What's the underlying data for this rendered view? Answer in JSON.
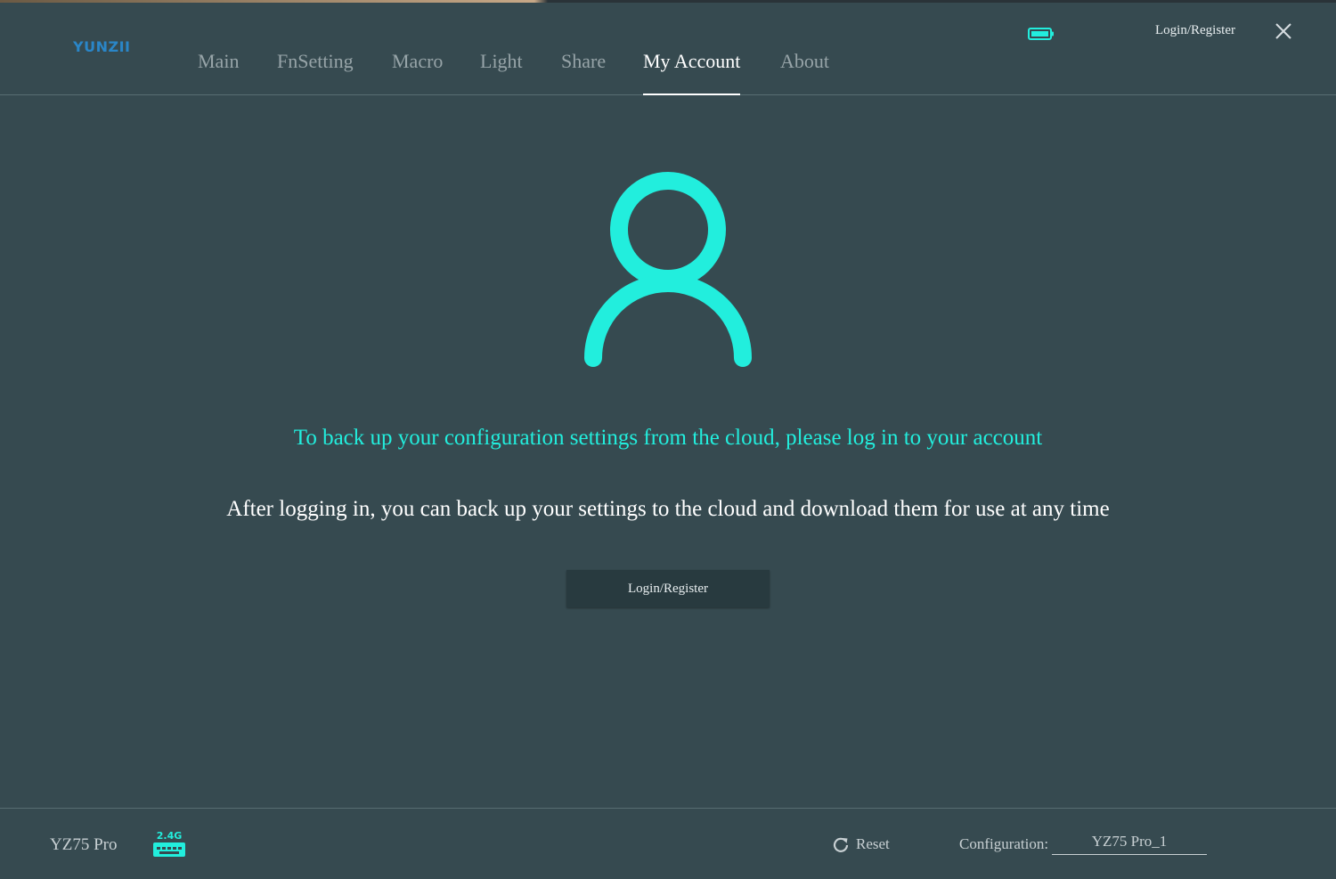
{
  "header": {
    "logo": "YUNZII",
    "tabs": [
      {
        "label": "Main",
        "active": false
      },
      {
        "label": "FnSetting",
        "active": false
      },
      {
        "label": "Macro",
        "active": false
      },
      {
        "label": "Light",
        "active": false
      },
      {
        "label": "Share",
        "active": false
      },
      {
        "label": "My Account",
        "active": true
      },
      {
        "label": "About",
        "active": false
      }
    ],
    "login_label": "Login/Register",
    "battery_icon": "battery-icon",
    "close_icon": "close-icon"
  },
  "account": {
    "avatar_icon": "user-icon",
    "headline": "To back up your configuration settings from the cloud, please log in to your account",
    "subtext": "After logging in, you can back up your settings to the cloud and download them for use at any time",
    "button_label": "Login/Register"
  },
  "footer": {
    "device_name": "YZ75 Pro",
    "connection_label": "2.4G",
    "reset_label": "Reset",
    "config_label": "Configuration:",
    "config_value": "YZ75 Pro_1"
  },
  "colors": {
    "background": "#364a50",
    "accent": "#22eedd",
    "logo": "#2a86c8",
    "button": "#283a3f"
  }
}
